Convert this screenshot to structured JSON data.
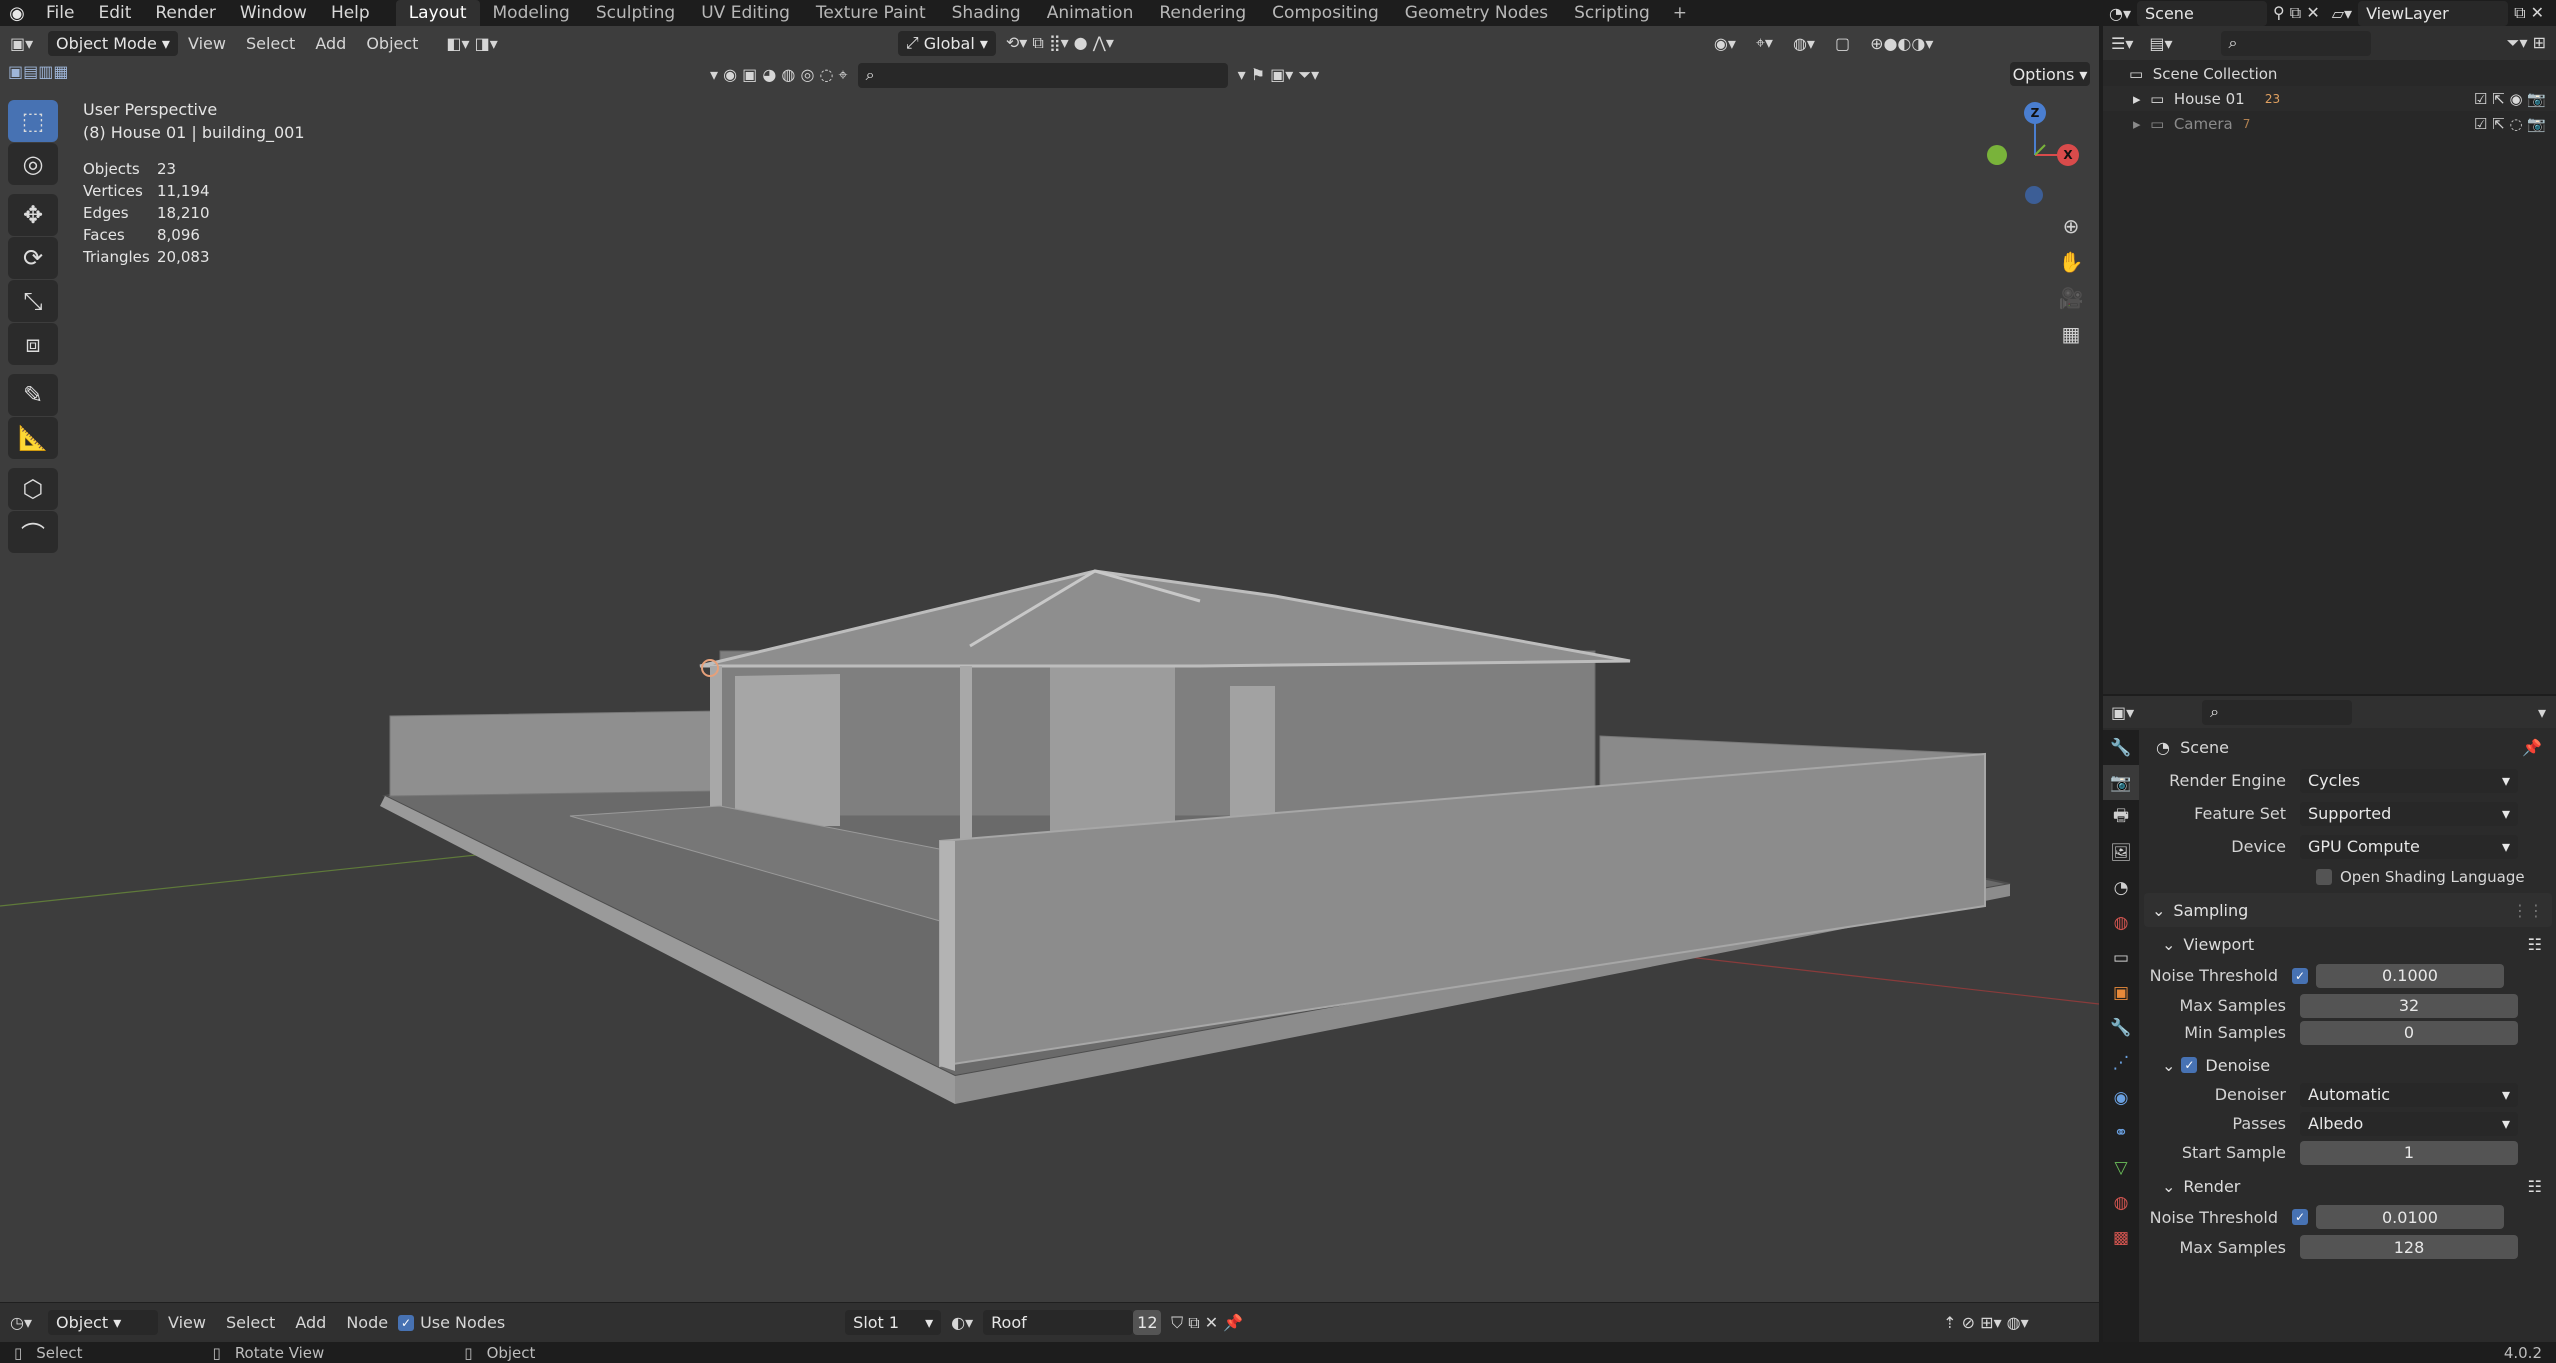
{
  "top": {
    "menus": [
      "File",
      "Edit",
      "Render",
      "Window",
      "Help"
    ],
    "workspaces": [
      "Layout",
      "Modeling",
      "Sculpting",
      "UV Editing",
      "Texture Paint",
      "Shading",
      "Animation",
      "Rendering",
      "Compositing",
      "Geometry Nodes",
      "Scripting"
    ],
    "active_workspace": "Layout",
    "scene": "Scene",
    "view_layer": "ViewLayer"
  },
  "viewport": {
    "mode": "Object Mode",
    "menus": [
      "View",
      "Select",
      "Add",
      "Object"
    ],
    "orientation": "Global",
    "options_label": "Options",
    "perspective": "User Perspective",
    "object_path": "(8) House 01 | building_001",
    "stats": [
      {
        "label": "Objects",
        "value": "23"
      },
      {
        "label": "Vertices",
        "value": "11,194"
      },
      {
        "label": "Edges",
        "value": "18,210"
      },
      {
        "label": "Faces",
        "value": "8,096"
      },
      {
        "label": "Triangles",
        "value": "20,083"
      }
    ],
    "gizmo_axes": {
      "z": "Z",
      "y": "Y",
      "x": "X"
    }
  },
  "node_header": {
    "editor": "Object",
    "menus": [
      "View",
      "Select",
      "Add",
      "Node"
    ],
    "use_nodes_label": "Use Nodes",
    "slot": "Slot 1",
    "material": "Roof",
    "users": "12"
  },
  "statusbar": {
    "select": "Select",
    "rotate": "Rotate View",
    "object": "Object",
    "version": "4.0.2"
  },
  "outliner": {
    "collection": "Scene Collection",
    "items": [
      {
        "name": "House 01",
        "count": "23"
      },
      {
        "name": "Camera",
        "count": "7"
      }
    ]
  },
  "properties": {
    "context": "Scene",
    "render_engine_label": "Render Engine",
    "render_engine": "Cycles",
    "feature_set_label": "Feature Set",
    "feature_set": "Supported",
    "device_label": "Device",
    "device": "GPU Compute",
    "osl_label": "Open Shading Language",
    "sampling": "Sampling",
    "viewport_sub": "Viewport",
    "vp_noise_label": "Noise Threshold",
    "vp_noise": "0.1000",
    "vp_max_label": "Max Samples",
    "vp_max": "32",
    "vp_min_label": "Min Samples",
    "vp_min": "0",
    "denoise_sub": "Denoise",
    "denoiser_label": "Denoiser",
    "denoiser": "Automatic",
    "passes_label": "Passes",
    "passes": "Albedo",
    "start_sample_label": "Start Sample",
    "start_sample": "1",
    "render_sub": "Render",
    "r_noise_label": "Noise Threshold",
    "r_noise": "0.0100",
    "r_max_label": "Max Samples",
    "r_max": "128"
  }
}
